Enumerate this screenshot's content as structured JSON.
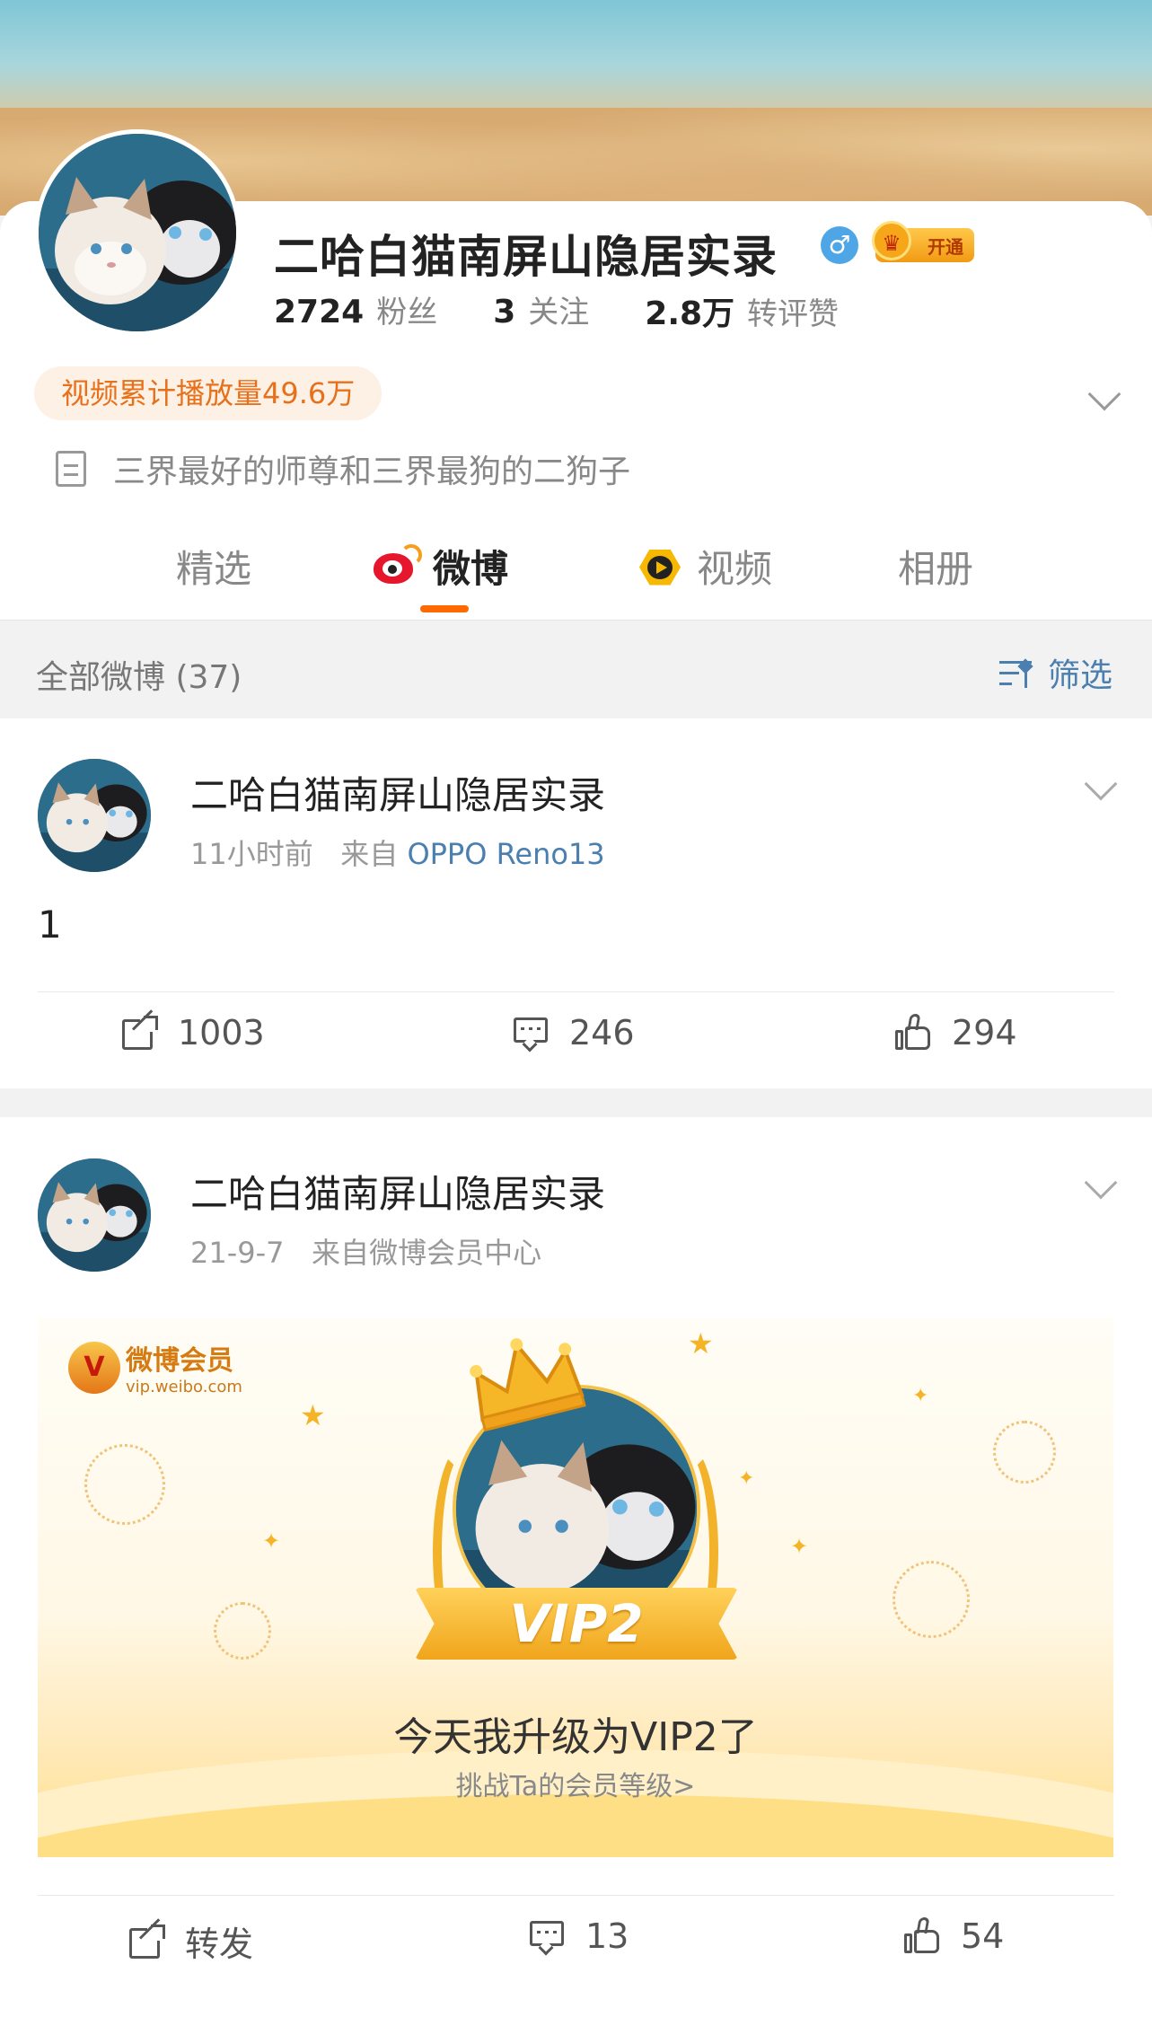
{
  "profile": {
    "name": "二哈白猫南屏山隐居实录",
    "gender_symbol": "♂",
    "vip_badge_label": "开通",
    "stats": [
      {
        "value": "2724",
        "label": "粉丝"
      },
      {
        "value": "3",
        "label": "关注"
      },
      {
        "value": "2.8万",
        "label": "转评赞"
      }
    ],
    "play_count_label": "视频累计播放量49.6万",
    "bio": "三界最好的师尊和三界最狗的二狗子"
  },
  "tabs": [
    {
      "label": "精选",
      "active": false
    },
    {
      "label": "微博",
      "active": true,
      "icon": "weibo-logo-icon"
    },
    {
      "label": "视频",
      "active": false,
      "icon": "video-play-icon"
    },
    {
      "label": "相册",
      "active": false
    }
  ],
  "filter": {
    "all_label": "全部微博 (37)",
    "filter_label": "筛选"
  },
  "posts": [
    {
      "author": "二哈白猫南屏山隐居实录",
      "time": "11小时前",
      "from_prefix": "来自",
      "source": "OPPO Reno13",
      "text": "1",
      "repost": "1003",
      "comments": "246",
      "likes": "294"
    },
    {
      "author": "二哈白猫南屏山隐居实录",
      "time": "21-9-7",
      "from_prefix": "来自",
      "source": "微博会员中心",
      "vip_card": {
        "logo_title": "微博会员",
        "logo_url_text": "vip.weibo.com",
        "ribbon": "VIP2",
        "title": "今天我升级为VIP2了",
        "subtitle": "挑战Ta的会员等级>"
      },
      "repost": "转发",
      "comments": "13",
      "likes": "54"
    }
  ],
  "colors": {
    "accent_orange": "#ff6a00",
    "link_blue": "#4a7fb0",
    "weibo_red": "#e6162d"
  }
}
